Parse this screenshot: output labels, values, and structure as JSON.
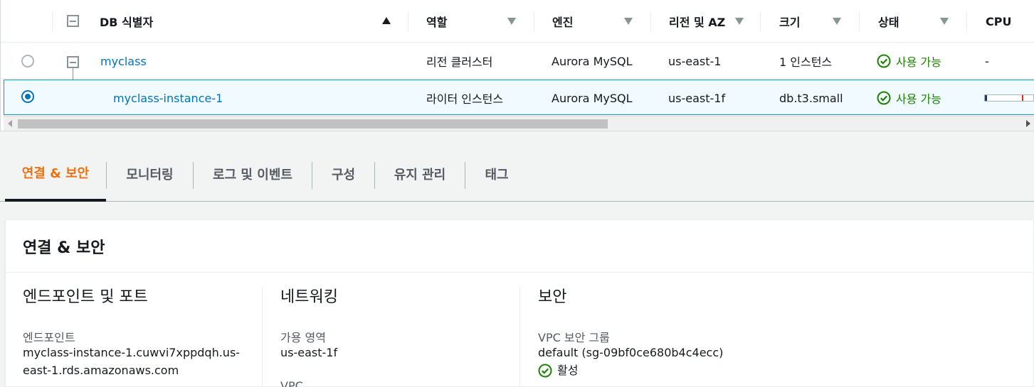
{
  "table": {
    "headers": {
      "db_id": "DB 식별자",
      "role": "역할",
      "engine": "엔진",
      "region": "리전 및 AZ",
      "size": "크기",
      "status": "상태",
      "cpu": "CPU"
    },
    "rows": [
      {
        "db_id": "myclass",
        "role": "리전 클러스터",
        "engine": "Aurora MySQL",
        "region": "us-east-1",
        "size": "1 인스턴스",
        "status": "사용 가능",
        "cpu": "-",
        "selected": false
      },
      {
        "db_id": "myclass-instance-1",
        "role": "라이터 인스턴스",
        "engine": "Aurora MySQL",
        "region": "us-east-1f",
        "size": "db.t3.small",
        "status": "사용 가능",
        "cpu_percent": 5,
        "selected": true
      }
    ]
  },
  "tabs": [
    {
      "label": "연결 & 보안",
      "active": true
    },
    {
      "label": "모니터링",
      "active": false
    },
    {
      "label": "로그 및 이벤트",
      "active": false
    },
    {
      "label": "구성",
      "active": false
    },
    {
      "label": "유지 관리",
      "active": false
    },
    {
      "label": "태그",
      "active": false
    }
  ],
  "panel": {
    "title": "연결 & 보안",
    "endpoint_section": {
      "heading": "엔드포인트 및 포트",
      "endpoint_label": "엔드포인트",
      "endpoint_value": "myclass-instance-1.cuwvi7xppdqh.us-east-1.rds.amazonaws.com"
    },
    "network_section": {
      "heading": "네트워킹",
      "az_label": "가용 영역",
      "az_value": "us-east-1f",
      "vpc_label": "VPC"
    },
    "security_section": {
      "heading": "보안",
      "sg_label": "VPC 보안 그룹",
      "sg_link": "default (sg-09bf0ce680b4c4ecc)",
      "sg_status": "활성"
    }
  },
  "colors": {
    "link": "#0073bb",
    "success": "#1d8102",
    "active_tab": "#ec7211",
    "selected_row_bg": "#f1faff",
    "selected_row_border": "#00a1c9"
  },
  "icons": {
    "status": "check-circle-icon",
    "expand": "collapse-square-icon",
    "sort": "caret-icon"
  }
}
